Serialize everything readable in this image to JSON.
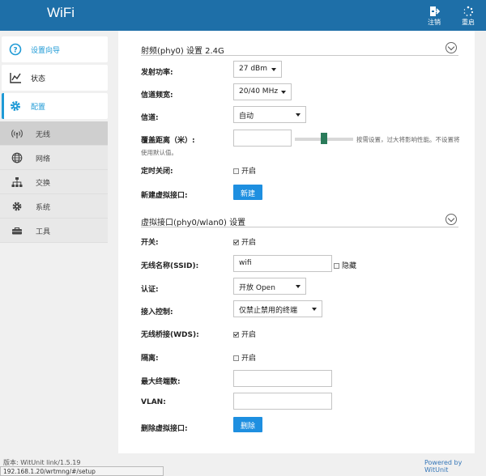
{
  "header": {
    "brand": "WiFi",
    "logout_label": "注销",
    "reboot_label": "重启"
  },
  "sidebar": {
    "top_items": [
      {
        "label": "设置向导",
        "icon": "question-circle-icon"
      },
      {
        "label": "状态",
        "icon": "line-chart-icon"
      },
      {
        "label": "配置",
        "icon": "gear-icon"
      }
    ],
    "sub_items": [
      {
        "label": "无线",
        "icon": "wifi-signal-icon"
      },
      {
        "label": "网络",
        "icon": "globe-icon"
      },
      {
        "label": "交换",
        "icon": "network-tree-icon"
      },
      {
        "label": "系统",
        "icon": "gear-icon"
      },
      {
        "label": "工具",
        "icon": "toolbox-icon"
      }
    ]
  },
  "radio_section": {
    "title": "射频(phy0) 设置 2.4G",
    "tx_power_label": "发射功率:",
    "tx_power_value": "27 dBm",
    "bandwidth_label": "信道频宽:",
    "bandwidth_value": "20/40 MHz",
    "channel_label": "信道:",
    "channel_value": "自动",
    "coverage_label": "覆盖距离（米）:",
    "coverage_value": "",
    "coverage_hint": "按需设置，过大将影响性能。不设置将",
    "coverage_hint2": "使用默认值。",
    "timer_off_label": "定时关闭:",
    "timer_off_option": "开启",
    "new_vif_label": "新建虚拟接口:",
    "new_vif_button": "新建"
  },
  "vif_section": {
    "title": "虚拟接口(phy0/wlan0) 设置",
    "switch_label": "开关:",
    "switch_option": "开启",
    "ssid_label": "无线名称(SSID):",
    "ssid_value": "wifi",
    "hide_option": "隐藏",
    "auth_label": "认证:",
    "auth_value": "开放 Open",
    "access_label": "接入控制:",
    "access_value": "仅禁止禁用的终端",
    "wds_label": "无线桥接(WDS):",
    "wds_option": "开启",
    "isolation_label": "隔离:",
    "isolation_option": "开启",
    "max_clients_label": "最大终端数:",
    "max_clients_value": "",
    "vlan_label": "VLAN:",
    "vlan_value": "",
    "delete_vif_label": "删除虚拟接口:",
    "delete_vif_button": "删除"
  },
  "footer": {
    "version": "版本: WitUnit link/1.5.19",
    "powered": "Powered by WitUnit",
    "status_url": "192.168.1.20/wrtmng/#/setup"
  }
}
